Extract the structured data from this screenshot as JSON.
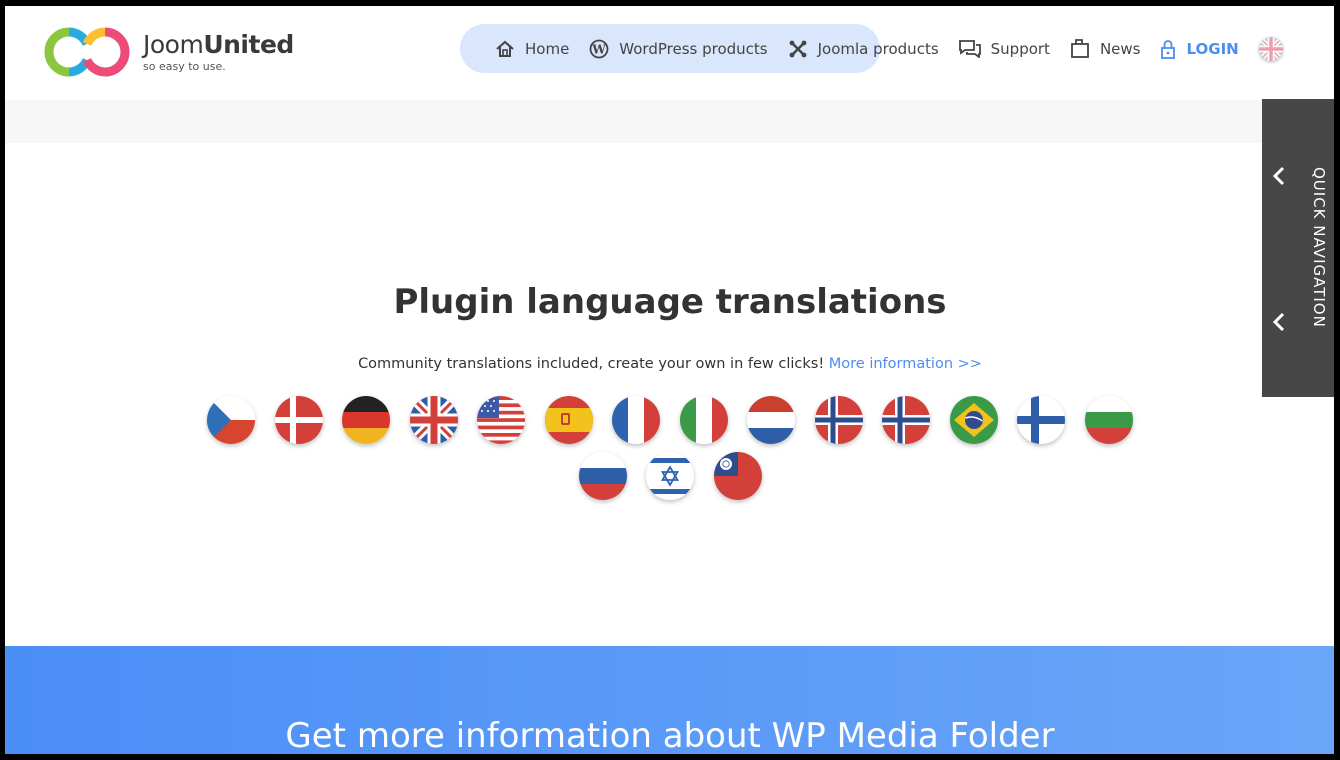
{
  "header": {
    "logo_name_regular": "Joom",
    "logo_name_bold": "United",
    "logo_tagline": "so easy to use.",
    "nav": [
      {
        "label": "Home",
        "icon": "home-icon"
      },
      {
        "label": "WordPress products",
        "icon": "wordpress-icon"
      },
      {
        "label": "Joomla products",
        "icon": "joomla-icon"
      },
      {
        "label": "Support",
        "icon": "chat-icon"
      },
      {
        "label": "News",
        "icon": "news-icon"
      },
      {
        "label": "LOGIN",
        "icon": "lock-icon"
      }
    ],
    "language_icon": "uk-flag-icon"
  },
  "quick_nav": {
    "label": "QUICK NAVIGATION"
  },
  "main": {
    "title": "Plugin language translations",
    "subtitle": "Community translations included, create your own in few clicks!",
    "more_link": "More information >>",
    "flags": [
      "czech-flag-icon",
      "danish-flag-icon",
      "german-flag-icon",
      "uk-flag-icon",
      "us-flag-icon",
      "spanish-flag-icon",
      "french-flag-icon",
      "italian-flag-icon",
      "dutch-flag-icon",
      "norwegian-flag-icon",
      "norwegian-flag-icon",
      "brazilian-flag-icon",
      "finnish-flag-icon",
      "bulgarian-flag-icon",
      "russian-flag-icon",
      "israeli-flag-icon",
      "taiwan-flag-icon"
    ]
  },
  "banner": {
    "title": "Get more information about WP Media Folder"
  },
  "colors": {
    "accent": "#4a8ef0",
    "quicknav_bg": "#474747",
    "banner_start": "#4a8ef7",
    "banner_end": "#6aa6f8"
  }
}
